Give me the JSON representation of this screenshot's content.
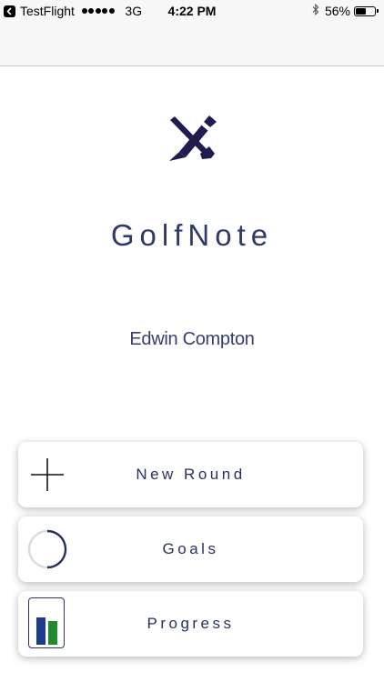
{
  "status_bar": {
    "carrier": "TestFlight",
    "network": "3G",
    "time": "4:22 PM",
    "battery": "56%",
    "battery_level": 0.56,
    "icons": [
      "back-to-app-icon",
      "signal-dots-icon",
      "bluetooth-icon",
      "battery-icon"
    ]
  },
  "app": {
    "title": "GolfNote",
    "user_name": "Edwin Compton",
    "logo_icon": "pencil-golf-club-cross-icon"
  },
  "menu": {
    "new_round": {
      "label": "New Round",
      "icon": "plus-icon"
    },
    "goals": {
      "label": "Goals",
      "icon": "progress-ring-icon"
    },
    "progress": {
      "label": "Progress",
      "icon": "bar-chart-icon"
    }
  },
  "colors": {
    "brand_navy": "#1f1c4f",
    "text_navy": "#2f3a6b",
    "bar_blue": "#1f3b8c",
    "bar_green": "#1f8b2e",
    "nav_bg": "#f7f7f7"
  }
}
